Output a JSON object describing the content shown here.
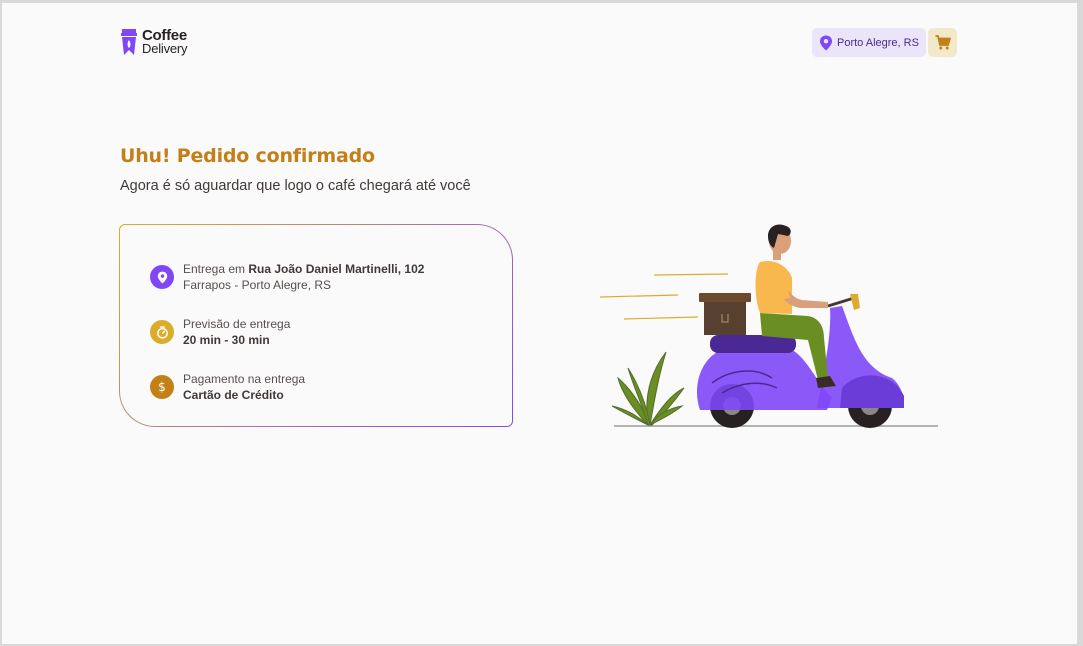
{
  "header": {
    "logo_line1": "Coffee",
    "logo_line2": "Delivery",
    "location": "Porto Alegre, RS",
    "brand_purple": "#8047f8",
    "brand_yellow": "#c47f17"
  },
  "confirmation": {
    "title": "Uhu! Pedido confirmado",
    "subtitle": "Agora é só aguardar que logo o café chegará até você"
  },
  "info": {
    "delivery": {
      "prefix": "Entrega em ",
      "address": "Rua João Daniel Martinelli, 102",
      "district": "Farrapos - Porto Alegre, RS",
      "icon": "map-pin-icon",
      "color": "#8047f8"
    },
    "forecast": {
      "label": "Previsão de entrega",
      "value": "20 min - 30 min",
      "icon": "timer-icon",
      "color": "#dbac2c"
    },
    "payment": {
      "label": "Pagamento na entrega",
      "value": "Cartão de Crédito",
      "icon": "currency-dollar-icon",
      "color": "#c47f17"
    }
  }
}
